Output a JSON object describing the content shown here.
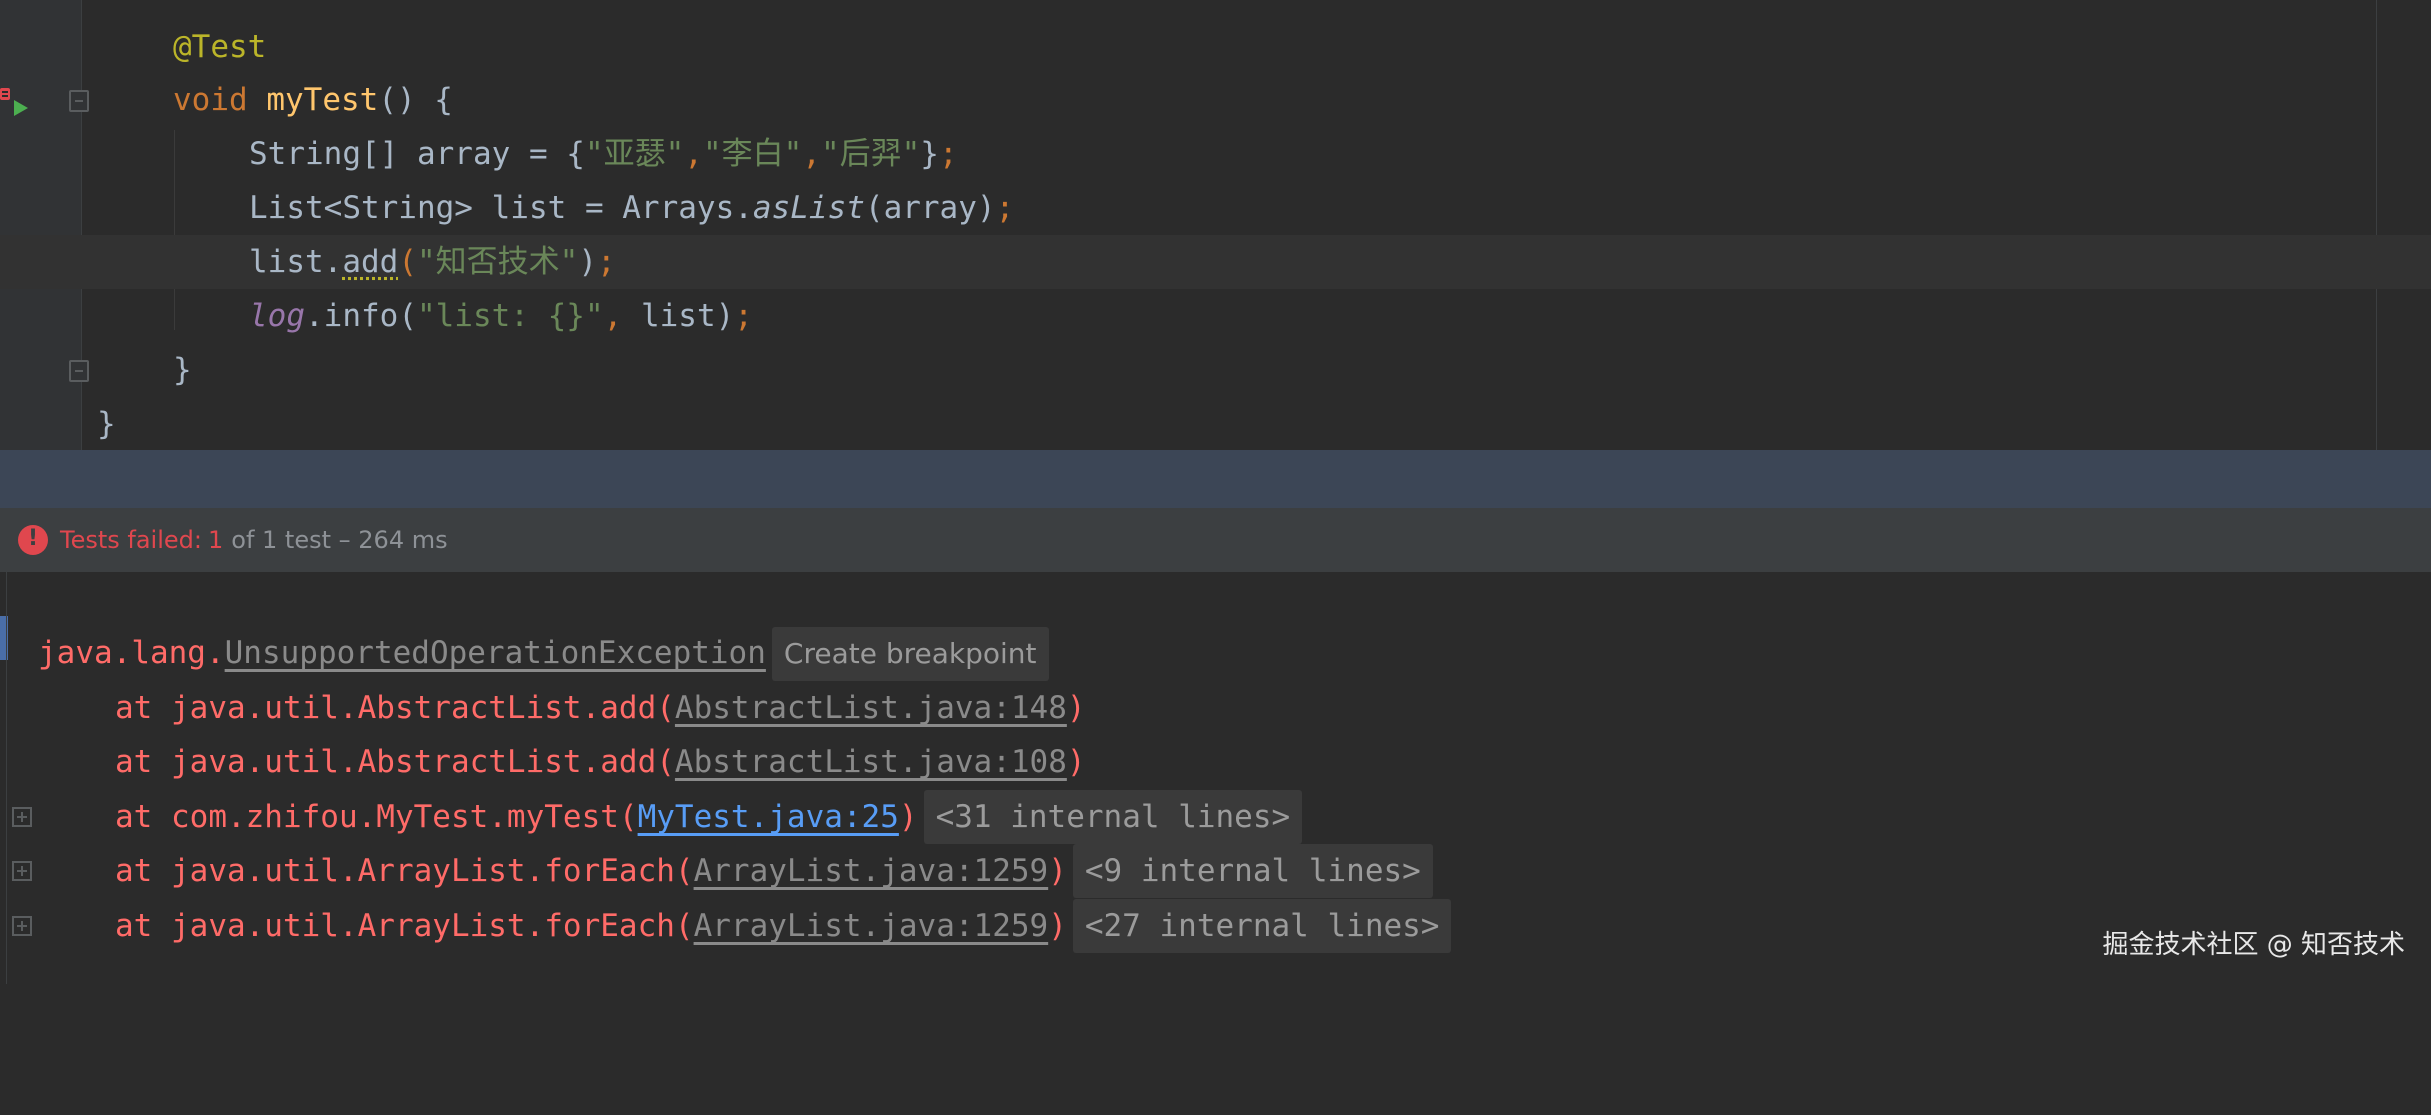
{
  "editor": {
    "lines": {
      "annotation": "@Test",
      "method_kw": "void",
      "method_name": "myTest",
      "method_rest": "() {",
      "array_type": "String[] array = {",
      "str1": "\"亚瑟\"",
      "comma1": ",",
      "str2": "\"李白\"",
      "comma2": ",",
      "str3": "\"后羿\"",
      "array_close": "}",
      "semi": ";",
      "list_decl": "List<String> list = Arrays.",
      "as_list": "asList",
      "as_list_args": "(array)",
      "list_prefix": "list.",
      "add_method": "add",
      "add_open": "(",
      "add_arg": "\"知否技术\"",
      "add_close": ")",
      "log_field": "log",
      "log_info": ".info(",
      "log_str": "\"list: {}\"",
      "log_comma": ",",
      "log_rest": " list)",
      "close_method": "}",
      "close_class": "}"
    }
  },
  "status": {
    "failed_label": "Tests failed:",
    "failed_count": "1",
    "rest": "of 1 test – 264 ms"
  },
  "console": {
    "exception_pkg": "java.lang.",
    "exception_class": "UnsupportedOperationException",
    "create_breakpoint": "Create breakpoint",
    "frames": [
      {
        "prefix": "at java.util.AbstractList.add(",
        "link": "AbstractList.java:148",
        "suffix": ")"
      },
      {
        "prefix": "at java.util.AbstractList.add(",
        "link": "AbstractList.java:108",
        "suffix": ")"
      },
      {
        "prefix": "at com.zhifou.MyTest.myTest(",
        "link": "MyTest.java:25",
        "suffix": ")",
        "internal": "<31 internal lines>"
      },
      {
        "prefix": "at java.util.ArrayList.forEach(",
        "link": "ArrayList.java:1259",
        "suffix": ")",
        "internal": "<9 internal lines>"
      },
      {
        "prefix": "at java.util.ArrayList.forEach(",
        "link": "ArrayList.java:1259",
        "suffix": ")",
        "internal": "<27 internal lines>"
      }
    ]
  },
  "watermark": "掘金技术社区 @ 知否技术",
  "colors": {
    "keyword": "#cc7832",
    "annotation": "#bbb529",
    "method": "#ffc66d",
    "string": "#6a8759",
    "error": "#e0474e",
    "stacktrace": "#ff6b68",
    "link": "#589df6"
  },
  "icons": [
    "run-test-icon",
    "fold-icon",
    "error-icon",
    "expand-icon"
  ]
}
